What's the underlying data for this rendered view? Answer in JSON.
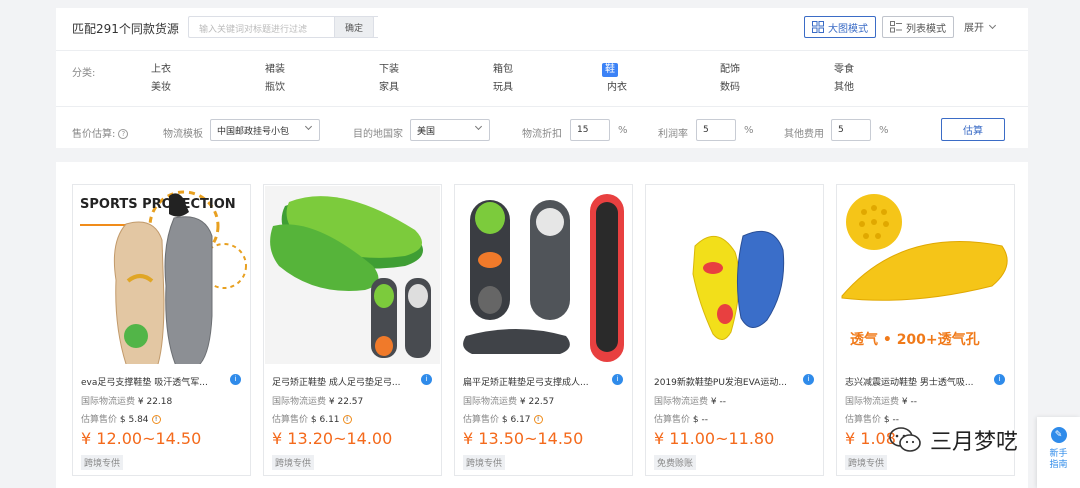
{
  "header": {
    "match_text": "匹配291个同款货源",
    "search_placeholder": "输入关键词对标题进行过滤",
    "confirm_label": "确定",
    "grid_mode_label": "大图模式",
    "list_mode_label": "列表模式",
    "expand_label": "展开"
  },
  "category": {
    "label": "分类:",
    "selected": "鞋",
    "items": [
      "上衣",
      "裙装",
      "下装",
      "箱包",
      "鞋",
      "配饰",
      "零食",
      "美妆",
      "瓶饮",
      "家具",
      "玩具",
      "内衣",
      "数码",
      "其他"
    ]
  },
  "pricing": {
    "label": "售价估算:",
    "logistics_template_label": "物流模板",
    "logistics_template_value": "中国邮政挂号小包",
    "destination_label": "目的地国家",
    "destination_value": "美国",
    "discount_label": "物流折扣",
    "discount_value": "15",
    "profit_label": "利润率",
    "profit_value": "5",
    "other_cost_label": "其他费用",
    "other_cost_value": "5",
    "percent": "%",
    "estimate_label": "估算"
  },
  "products": [
    {
      "title": "eva足弓支撑鞋垫 吸汗透气军...",
      "ship_label": "国际物流运费",
      "ship_value": "¥ 22.18",
      "est_label": "估算售价",
      "est_value": "$ 5.84",
      "price": "¥ 12.00~14.50",
      "tag": "跨境专供",
      "image_text": "SPORTS PROTECTION"
    },
    {
      "title": "足弓矫正鞋垫 成人足弓垫足弓...",
      "ship_label": "国际物流运费",
      "ship_value": "¥ 22.57",
      "est_label": "估算售价",
      "est_value": "$ 6.11",
      "price": "¥ 13.20~14.00",
      "tag": "跨境专供"
    },
    {
      "title": "扁平足矫正鞋垫足弓支撑成人...",
      "ship_label": "国际物流运费",
      "ship_value": "¥ 22.57",
      "est_label": "估算售价",
      "est_value": "$ 6.17",
      "price": "¥ 13.50~14.50",
      "tag": "跨境专供"
    },
    {
      "title": "2019新款鞋垫PU发泡EVA运动...",
      "ship_label": "国际物流运费",
      "ship_value": "¥ --",
      "est_label": "估算售价",
      "est_value": "$ --",
      "price": "¥ 11.00~11.80",
      "tag": "免费赊账"
    },
    {
      "title": "志兴减震运动鞋垫 男士透气吸...",
      "ship_label": "国际物流运费",
      "ship_value": "¥ --",
      "est_label": "估算售价",
      "est_value": "$ --",
      "price": "¥ 1.08",
      "tag": "跨境专供",
      "image_text": "透气 • 200+透气孔"
    }
  ],
  "badge_icon": "i",
  "watermark": {
    "text": "三月梦呓"
  },
  "guide": {
    "label": "新手指南"
  },
  "colors": {
    "accent": "#3b6cc6",
    "price": "#f46a1c",
    "selected_category": "#3b82f6"
  }
}
